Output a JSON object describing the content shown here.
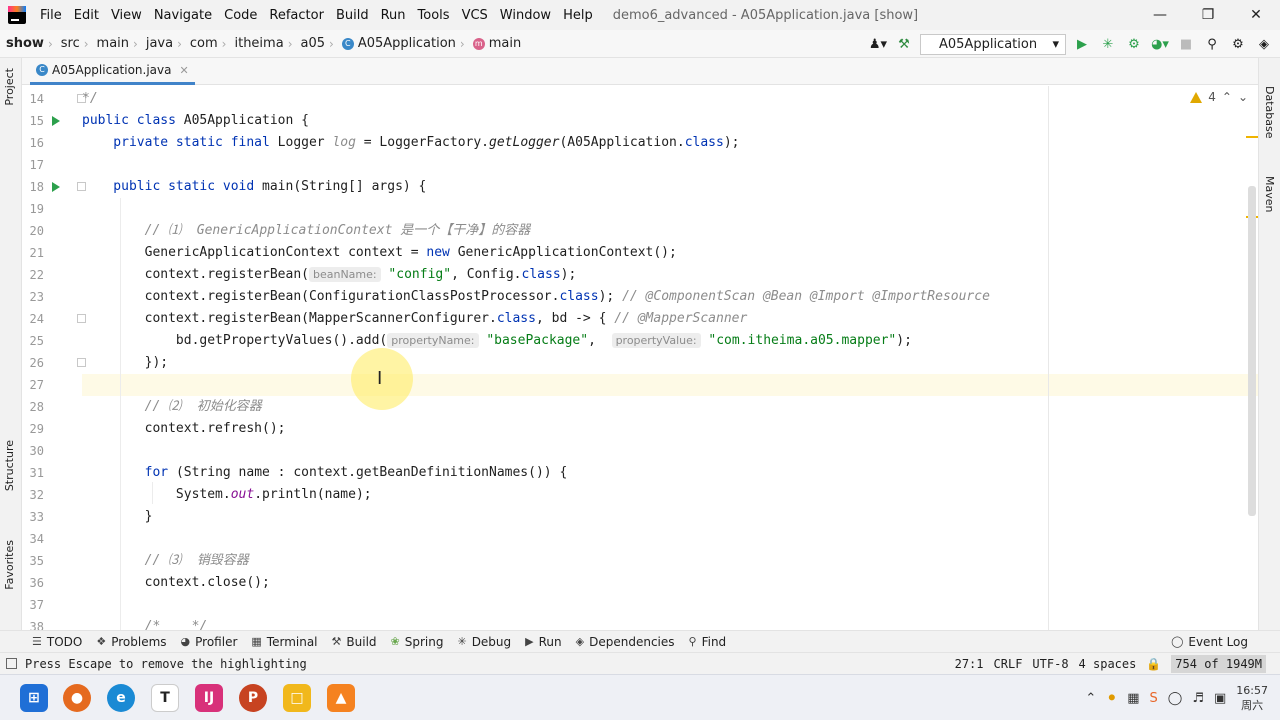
{
  "menubar": {
    "items": [
      "File",
      "Edit",
      "View",
      "Navigate",
      "Code",
      "Refactor",
      "Build",
      "Run",
      "Tools",
      "VCS",
      "Window",
      "Help"
    ],
    "window_title": "demo6_advanced - A05Application.java [show]"
  },
  "navbar": {
    "crumbs": [
      "show",
      "src",
      "main",
      "java",
      "com",
      "itheima",
      "a05",
      "A05Application",
      "main"
    ],
    "run_config": "A05Application"
  },
  "side_tabs": {
    "left": [
      "Project",
      "Structure",
      "Favorites"
    ],
    "right": [
      "Database",
      "Maven"
    ]
  },
  "editor": {
    "tab": "A05Application.java",
    "warnings_count": "4",
    "line_numbers": [
      "14",
      "15",
      "16",
      "17",
      "18",
      "19",
      "20",
      "21",
      "22",
      "23",
      "24",
      "25",
      "26",
      "27",
      "28",
      "29",
      "30",
      "31",
      "32",
      "33",
      "34",
      "35",
      "36",
      "37",
      "38"
    ],
    "code": {
      "l14": "*/",
      "l15a": "public class ",
      "l15b": "A05Application {",
      "l16a": "    private static final ",
      "l16b": "Logger ",
      "l16c": "log",
      "l16d": " = LoggerFactory.",
      "l16e": "getLogger",
      "l16f": "(A05Application.",
      "l16g": "class",
      "l16h": ");",
      "l18a": "    public static void ",
      "l18b": "main(String[] args) {",
      "l20": "        // ⑴  GenericApplicationContext 是一个【干净】的容器",
      "l21a": "        GenericApplicationContext context = ",
      "l21b": "new ",
      "l21c": "GenericApplicationContext();",
      "l22a": "        context.registerBean(",
      "l22hint": "beanName:",
      "l22b": " \"config\"",
      "l22c": ", Config.",
      "l22d": "class",
      "l22e": ");",
      "l23a": "        context.registerBean(ConfigurationClassPostProcessor.",
      "l23b": "class",
      "l23c": "); ",
      "l23d": "// @ComponentScan @Bean @Import @ImportResource",
      "l24a": "        context.registerBean(MapperScannerConfigurer.",
      "l24b": "class",
      "l24c": ", bd -> { ",
      "l24d": "// @MapperScanner",
      "l25a": "            bd.getPropertyValues().add(",
      "l25hint1": "propertyName:",
      "l25b": " \"basePackage\"",
      "l25c": ",  ",
      "l25hint2": "propertyValue:",
      "l25d": " \"com.itheima.a05.mapper\"",
      "l25e": ");",
      "l26": "        });",
      "l28": "        // ⑵  初始化容器",
      "l29": "        context.refresh();",
      "l31a": "        ",
      "l31b": "for ",
      "l31c": "(String name : context.getBeanDefinitionNames()) {",
      "l32a": "            System.",
      "l32b": "out",
      "l32c": ".println(name);",
      "l33": "        }",
      "l35": "        // ⑶  销毁容器",
      "l36": "        context.close();",
      "l38": "        /*    */"
    }
  },
  "tool_tabs": [
    "TODO",
    "Problems",
    "Profiler",
    "Terminal",
    "Build",
    "Spring",
    "Debug",
    "Run",
    "Dependencies",
    "Find",
    "Event Log"
  ],
  "status": {
    "message": "Press Escape to remove the highlighting",
    "position": "27:1",
    "line_sep": "CRLF",
    "encoding": "UTF-8",
    "indent": "4 spaces",
    "memory": "754 of 1949M"
  },
  "taskbar": {
    "time": "16:57",
    "day": "周六"
  },
  "colors": {
    "keyword": "#0033b3",
    "string": "#067d17",
    "comment": "#8c8c8c",
    "current_line": "#fefae6",
    "cursor_highlight": "#ffeb5a"
  }
}
